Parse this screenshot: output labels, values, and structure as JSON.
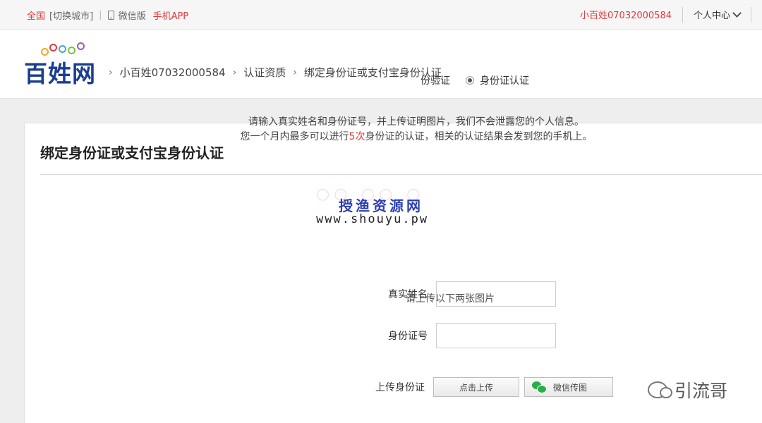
{
  "topbar": {
    "city": "全国",
    "switch_city": "[切换城市]",
    "wechat_version": "微信版",
    "mobile_app": "手机APP",
    "username": "小百姓07032000584",
    "personal_center": "个人中心"
  },
  "header": {
    "logo_text": "百姓网",
    "breadcrumbs": [
      "小百姓07032000584",
      "认证资质",
      "绑定身份证或支付宝身份认证"
    ]
  },
  "panel": {
    "title": "绑定身份证或支付宝身份认证",
    "radio_option_1": "份验证",
    "radio_option_2": "身份证认证",
    "info_line1": "请输入真实姓名和身份证号，并上传证明图片，我们不会泄露您的个人信息。",
    "info_line2_a": "您一个月内最多可以进行",
    "info_line2_highlight": "5次",
    "info_line2_b": "身份证的认证，相关的认证结果会发到您的手机上。",
    "name_label": "真实姓名",
    "id_label": "身份证号",
    "upload_label": "上传身份证",
    "upload_button": "点击上传",
    "wechat_upload_button": "微信传图",
    "cutoff_text": "请上传以下两张图片"
  },
  "watermark": {
    "title": "授渔资源网",
    "url": "www.shouyu.pw",
    "brand": "引流哥"
  },
  "colors": {
    "accent_red": "#e4393c",
    "logo_blue": "#1a3e8f",
    "wechat_green": "#2aae47"
  }
}
